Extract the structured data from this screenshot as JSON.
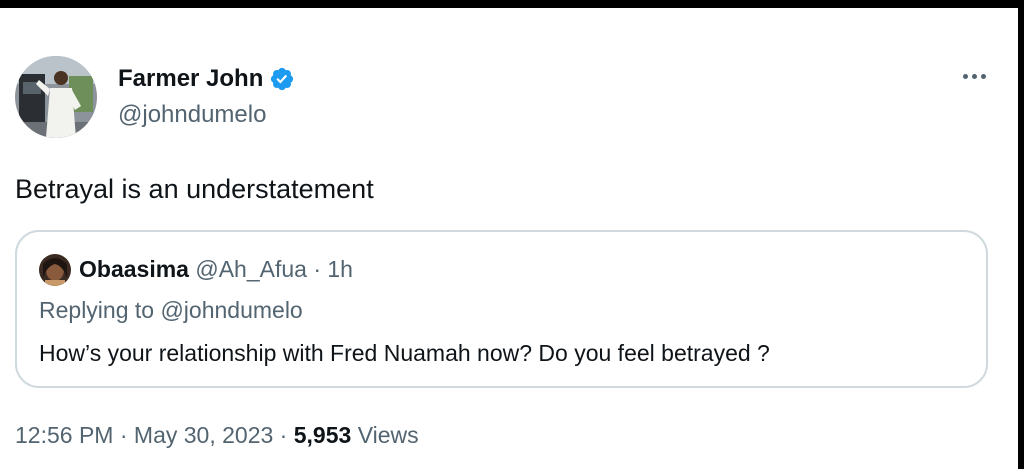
{
  "colors": {
    "text_primary": "#0f1419",
    "text_secondary": "#536471",
    "verified_blue": "#1d9bf0",
    "border": "#cfd9de"
  },
  "author": {
    "name": "Farmer John",
    "handle": "@johndumelo",
    "verified_icon": "verified-badge-icon"
  },
  "tweet": {
    "text": "Betrayal is an understatement"
  },
  "quoted": {
    "name": "Obaasima",
    "handle": "@Ah_Afua",
    "separator": "·",
    "time": "1h",
    "replying_to": "Replying to @johndumelo",
    "text": "How’s your relationship with Fred Nuamah now? Do you feel betrayed ?"
  },
  "meta": {
    "time": "12:56 PM",
    "date": "May 30, 2023",
    "separator": "·",
    "views_count": "5,953",
    "views_label": "Views"
  }
}
